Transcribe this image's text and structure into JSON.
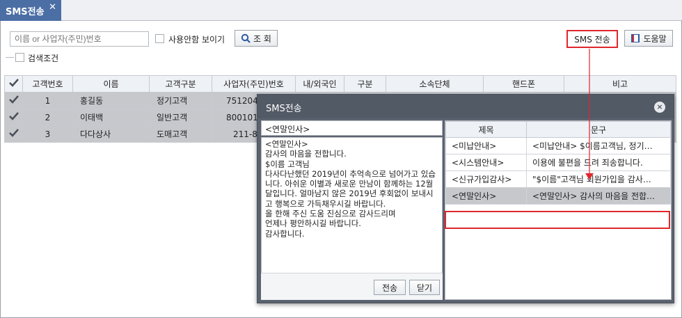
{
  "tab": {
    "label": "SMS전송",
    "close": "✕"
  },
  "toolbar": {
    "search_placeholder": "이름 or 사업자(주민)번호",
    "show_unused_label": "사용안함 보이기",
    "search_button": "조 회",
    "sms_button": "SMS 전송",
    "help_button": "도움말",
    "filter_label": "검색조건"
  },
  "grid": {
    "headers": [
      "고객번호",
      "이름",
      "고객구분",
      "사업자(주민)번호",
      "내/외국인",
      "구분",
      "소속단체",
      "핸드폰",
      "비고"
    ],
    "rows": [
      {
        "no": "1",
        "name": "홍길동",
        "type": "정기고객",
        "biz": "751204-"
      },
      {
        "no": "2",
        "name": "이태백",
        "type": "일반고객",
        "biz": "800101-"
      },
      {
        "no": "3",
        "name": "다다상사",
        "type": "도매고객",
        "biz": "211-86-"
      }
    ]
  },
  "modal": {
    "title": "SMS전송",
    "close": "×",
    "message_title": "<연말인사>",
    "message_body": "<연말인사>\n감사의 마음을 전합니다.\n$이름 고객님\n다사다난했던 2019년이 추억속으로 넘어가고 있습니다. 아쉬운 이별과 새로운 만남이 함께하는 12월 달입니다. 얼마남지 않은 2019년 후회없이 보내시고 행복으로 가득채우시길 바랍니다.\n올 한해 주신 도움 진심으로 감사드리며\n언제나 평안하시길 바랍니다.\n감사합니다.",
    "send_button": "전송",
    "close_button": "닫기",
    "msg_headers": [
      "제목",
      "문구"
    ],
    "messages": [
      {
        "title": "<미납안내>",
        "text": "<미납안내> $이름고객님, 정기…"
      },
      {
        "title": "<시스템안내>",
        "text": "이용에 불편을 드려 죄송합니다."
      },
      {
        "title": "<신규가입감사>",
        "text": "\"$이름\"고객님 회원가입을 감사…"
      },
      {
        "title": "<연말인사>",
        "text": "<연말인사> 감사의 마음을 전합…"
      }
    ]
  },
  "colors": {
    "tab": "#4b6ea5",
    "highlight": "#e0262b",
    "modal_header": "#525a66"
  }
}
